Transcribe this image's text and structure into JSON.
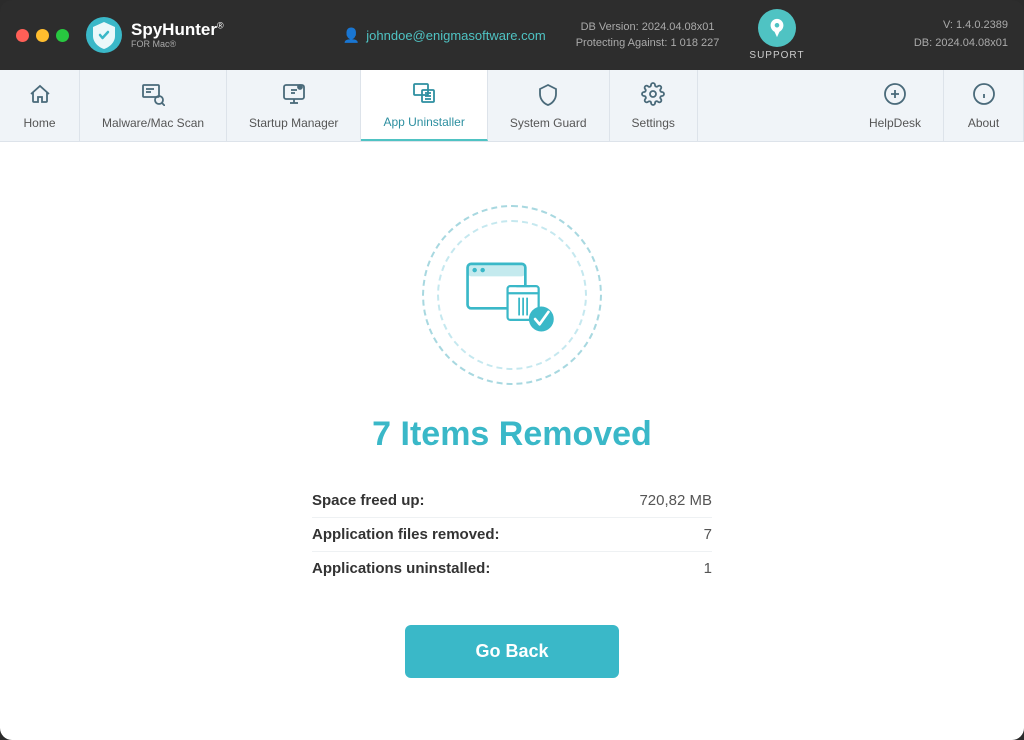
{
  "window": {
    "title": "SpyHunter for Mac"
  },
  "titlebar": {
    "logo_text": "SpyHunter",
    "logo_superscript": "®",
    "logo_for_mac": "FOR Mac®",
    "user_email": "johndoe@enigmasoftware.com",
    "db_version_label": "DB Version: 2024.04.08x01",
    "protecting_label": "Protecting Against: 1 018 227",
    "support_label": "SUPPORT",
    "version_line1": "V: 1.4.0.2389",
    "version_line2": "DB:  2024.04.08x01"
  },
  "navbar": {
    "items": [
      {
        "id": "home",
        "label": "Home",
        "icon": "🏠"
      },
      {
        "id": "malware",
        "label": "Malware/Mac Scan",
        "icon": "🔍"
      },
      {
        "id": "startup",
        "label": "Startup Manager",
        "icon": "🖥"
      },
      {
        "id": "uninstaller",
        "label": "App Uninstaller",
        "icon": "📦",
        "active": true
      },
      {
        "id": "system-guard",
        "label": "System Guard",
        "icon": "🛡"
      },
      {
        "id": "settings",
        "label": "Settings",
        "icon": "⚙️"
      }
    ],
    "right_items": [
      {
        "id": "helpdesk",
        "label": "HelpDesk",
        "icon": "➕"
      },
      {
        "id": "about",
        "label": "About",
        "icon": "ℹ"
      }
    ]
  },
  "result": {
    "title": "7 Items Removed",
    "stats": [
      {
        "label": "Space freed up:",
        "value": "720,82 MB"
      },
      {
        "label": "Application files removed:",
        "value": "7"
      },
      {
        "label": "Applications uninstalled:",
        "value": "1"
      }
    ],
    "go_back_label": "Go Back"
  }
}
